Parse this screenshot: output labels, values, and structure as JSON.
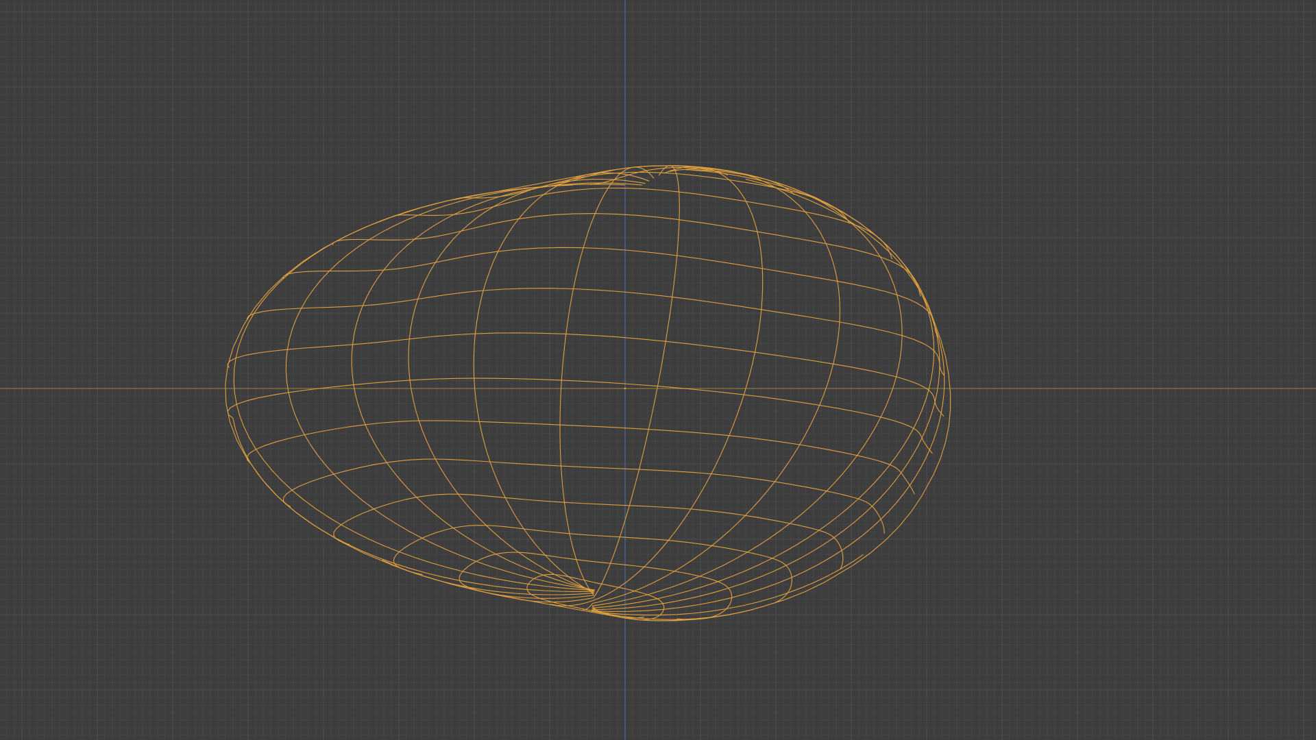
{
  "viewport": {
    "view": "3d-viewport-wireframe",
    "background_color": "#3d3d3d",
    "grid": {
      "visible": true,
      "minor_color": "#474747",
      "major_color": "#4f4f4f"
    },
    "axes": {
      "x_axis_color": "#8a7a3a",
      "z_axis_color": "#4a6a9a"
    },
    "origin_marker_color": "#e0a040",
    "mesh": {
      "name": "",
      "wire_color": "#e0a040",
      "selected": true,
      "shape": "uv-sphere-deformed",
      "rings": 16,
      "segments": 24
    }
  }
}
